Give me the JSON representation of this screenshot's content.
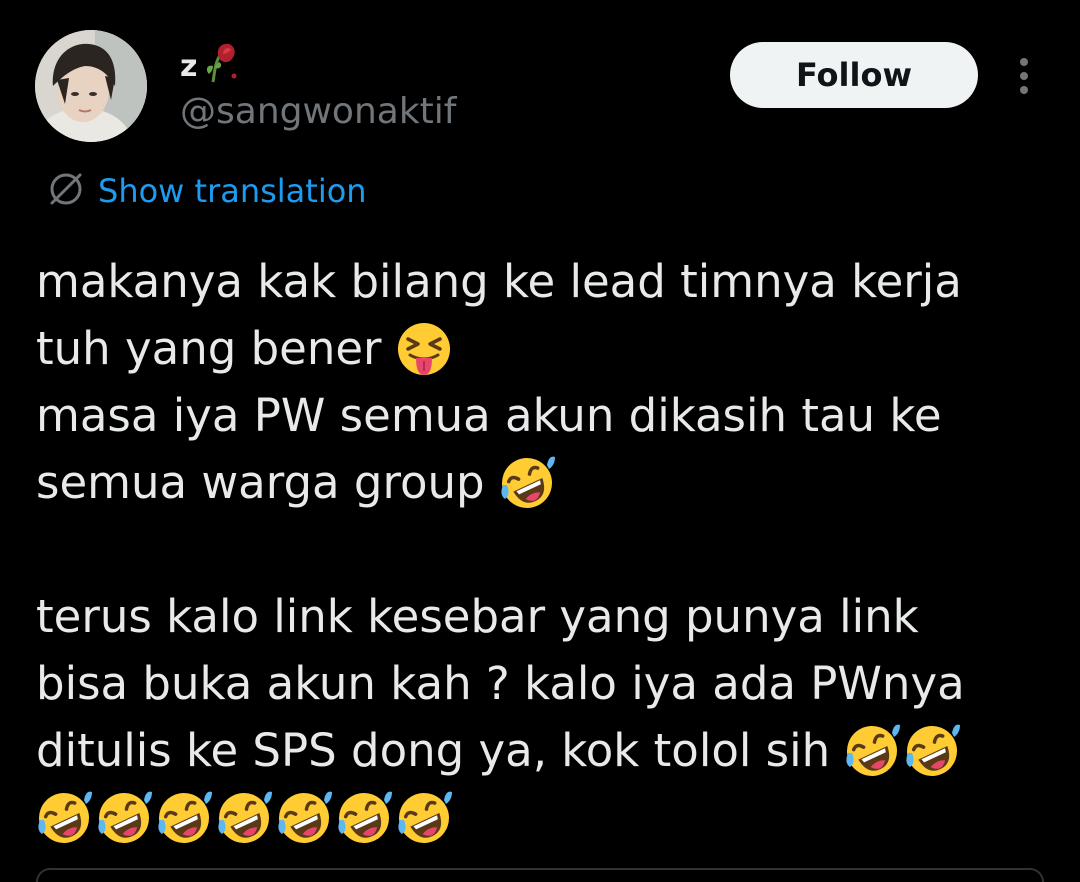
{
  "author": {
    "display_name": "z",
    "display_name_emoji": "wilted-rose-emoji",
    "handle": "@sangwonaktif",
    "avatar": "profile-photo"
  },
  "header": {
    "follow_label": "Follow",
    "more_icon": "more-vertical-icon"
  },
  "translation": {
    "icon": "globe-icon",
    "label": "Show translation"
  },
  "tweet": {
    "paragraph1": {
      "line1": "makanya kak bilang ke lead timnya kerja",
      "line2": "tuh yang bener",
      "line2_emoji": "squinting-face-with-tongue-emoji",
      "line3": "masa iya PW semua akun dikasih tau ke",
      "line4": "semua warga group",
      "line4_emoji": "rolling-on-floor-laughing-emoji"
    },
    "paragraph2": {
      "line1": "terus kalo link kesebar yang punya link",
      "line2": "bisa buka akun kah ? kalo iya ada PWnya",
      "line3": "ditulis ke SPS dong ya, kok tolol sih",
      "line3_emoji_count": 2,
      "line4_emoji_count": 7,
      "emoji": "rolling-on-floor-laughing-emoji"
    }
  },
  "colors": {
    "background": "#000000",
    "text_primary": "#e7e9ea",
    "text_secondary": "#71767b",
    "link": "#1d9bf0",
    "follow_bg": "#eff3f4",
    "follow_text": "#0f1419"
  }
}
